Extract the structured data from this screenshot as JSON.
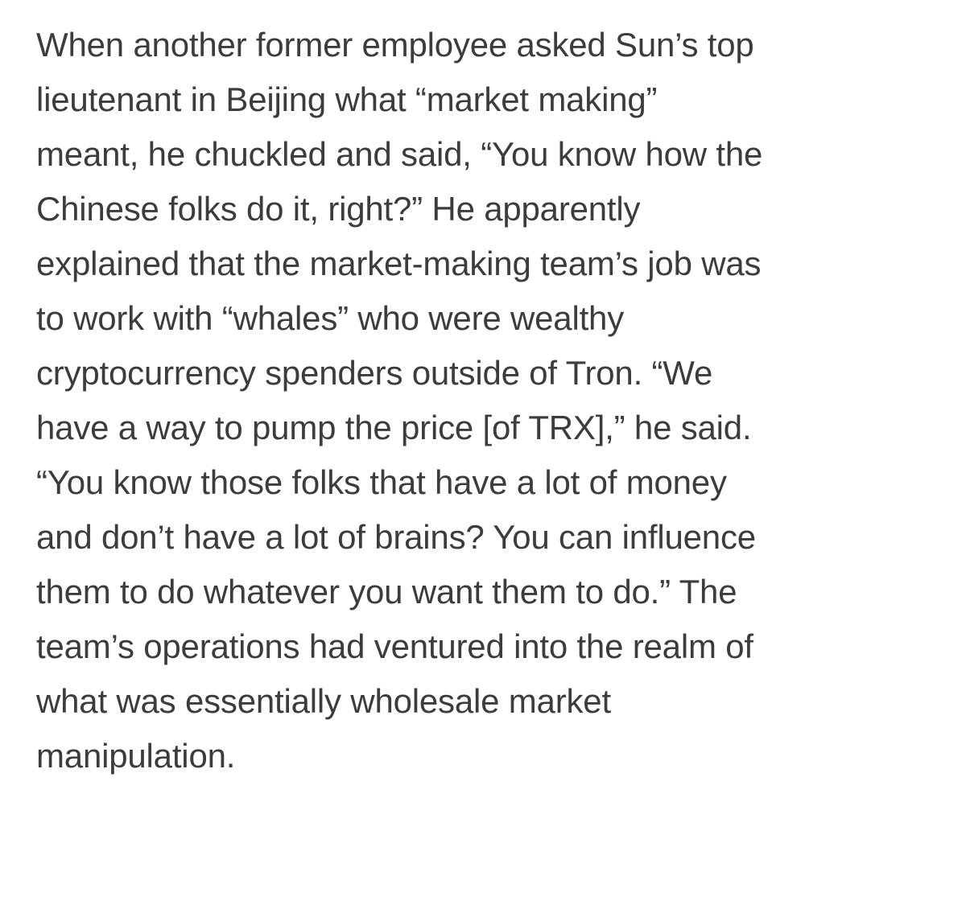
{
  "article": {
    "lines": [
      "When another former employee asked Sun’s top",
      "lieutenant in Beijing what “market making”",
      "meant, he chuckled and said, “You know how the",
      "Chinese folks do it, right?” He apparently",
      "explained that the market-making team’s job was",
      "to work with “whales” who were wealthy",
      "cryptocurrency spenders outside of Tron. “We",
      "have a way to pump the price [of TRX],” he said.",
      "“You know those folks that have a lot of money",
      "and don’t have a lot of brains? You can influence",
      "them to do whatever you want them to do.” The",
      "team’s operations had ventured into the realm of",
      "what was essentially wholesale market",
      "manipulation."
    ]
  }
}
